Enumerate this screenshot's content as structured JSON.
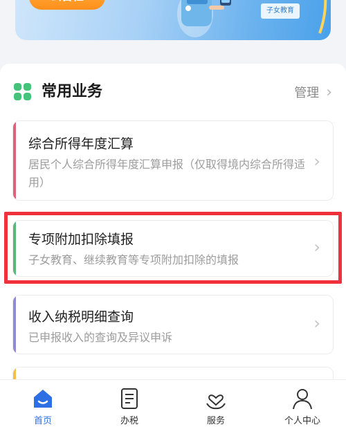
{
  "banner": {
    "pill_text": "公告栏",
    "tag_text": "子女教育"
  },
  "section": {
    "title": "常用业务",
    "manage_label": "管理",
    "icon": "grid-icon"
  },
  "items": [
    {
      "title": "综合所得年度汇算",
      "description": "居民个人综合所得年度汇算申报（仅取得境内综合所得适用）",
      "accent_color": "#e0607a"
    },
    {
      "title": "专项附加扣除填报",
      "description": "子女教育、继续教育等专项附加扣除的填报",
      "accent_color": "#59b879"
    },
    {
      "title": "收入纳税明细查询",
      "description": "已申报收入的查询及异议申诉",
      "accent_color": "#8e8ad6"
    }
  ],
  "bottom_nav": [
    {
      "label": "首页",
      "icon": "home-icon",
      "active": true
    },
    {
      "label": "办税",
      "icon": "tax-form-icon",
      "active": false
    },
    {
      "label": "服务",
      "icon": "heart-hand-icon",
      "active": false
    },
    {
      "label": "个人中心",
      "icon": "person-icon",
      "active": false
    }
  ],
  "colors": {
    "highlight_border": "#f0303a",
    "active_nav": "#2f6fe4",
    "section_icon": "#46c37b"
  }
}
